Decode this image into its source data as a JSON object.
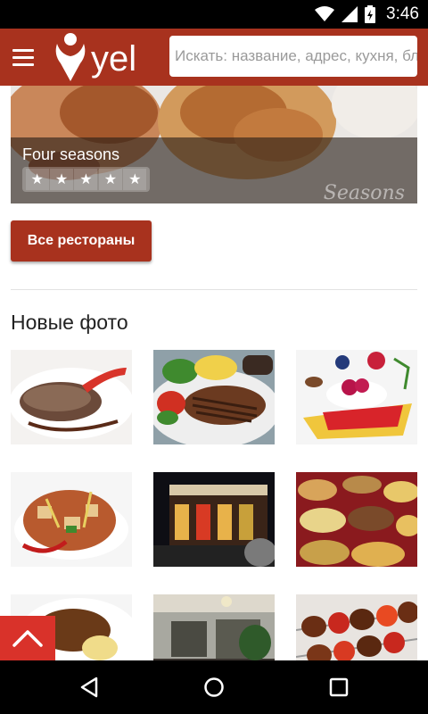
{
  "status_bar": {
    "time": "3:46"
  },
  "app_bar": {
    "logo_text": "yel",
    "search_placeholder": "Искать: название, адрес, кухня, бл..."
  },
  "featured": {
    "name": "Four seasons",
    "rating_stars": 5,
    "watermark": "Seasons"
  },
  "all_restaurants_button": "Все рестораны",
  "new_photos_title": "Новые фото",
  "photos": [
    "steak-with-sauce",
    "grilled-steak-vegetables",
    "dessert-berries",
    "stir-fry-dish",
    "restaurant-exterior",
    "buffet-dishes",
    "plated-dish",
    "restaurant-interior",
    "kebab-skewers"
  ],
  "colors": {
    "brand": "#a8321e",
    "scroll_top": "#d9322a"
  }
}
